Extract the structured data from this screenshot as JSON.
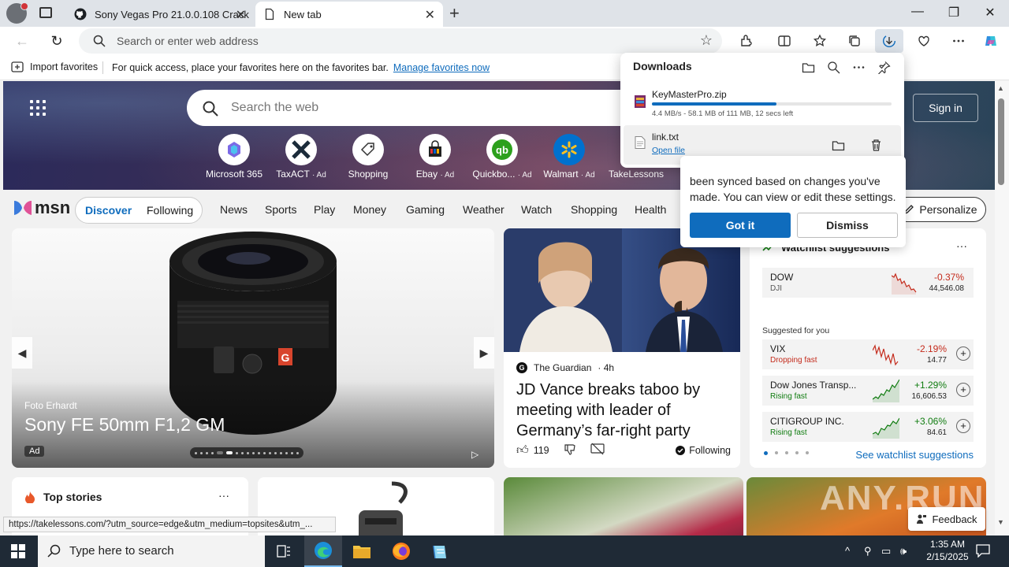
{
  "browser": {
    "tabs": [
      {
        "title": "Sony Vegas Pro 21.0.0.108 Crack",
        "icon": "github-icon",
        "active": false
      },
      {
        "title": "New tab",
        "icon": "page-icon",
        "active": true
      }
    ],
    "close_glyph": "✕",
    "new_tab_glyph": "+",
    "window_controls": [
      "—",
      "❐",
      "✕"
    ]
  },
  "toolbar": {
    "address_placeholder": "Search or enter web address",
    "back_glyph": "←",
    "refresh_glyph": "↻",
    "star_glyph": "☆"
  },
  "favorites_bar": {
    "import_label": "Import favorites",
    "message": "For quick access, place your favorites here on the favorites bar.",
    "manage_link": "Manage favorites now"
  },
  "downloads": {
    "title": "Downloads",
    "items": [
      {
        "name": "KeyMasterPro.zip",
        "status": "4.4 MB/s - 58.1 MB of 111 MB, 12 secs left",
        "progress": 0.52
      },
      {
        "name": "link.txt",
        "action": "Open file"
      }
    ]
  },
  "sync_popup": {
    "text": "been synced based on changes you've made. You can view or edit these settings.",
    "got_it": "Got it",
    "dismiss": "Dismiss"
  },
  "newtab": {
    "search_placeholder": "Search the web",
    "sign_in": "Sign in",
    "quick_links": [
      {
        "label": "Microsoft 365",
        "ad": ""
      },
      {
        "label": "TaxACT",
        "ad": "· Ad"
      },
      {
        "label": "Shopping",
        "ad": ""
      },
      {
        "label": "Ebay",
        "ad": "· Ad"
      },
      {
        "label": "Quickbo...",
        "ad": "· Ad"
      },
      {
        "label": "Walmart",
        "ad": "· Ad"
      },
      {
        "label": "TakeLessons",
        "ad": ""
      }
    ]
  },
  "msn": {
    "logo": "msn",
    "discover": "Discover",
    "following": "Following",
    "nav": [
      "News",
      "Sports",
      "Play",
      "Money",
      "Gaming",
      "Weather",
      "Watch",
      "Shopping",
      "Health"
    ],
    "personalize": "Personalize"
  },
  "carousel": {
    "credit": "Foto Erhardt",
    "headline": "Sony FE 50mm F1,2 GM",
    "ad_badge": "Ad"
  },
  "news": {
    "source": "The Guardian",
    "age": "· 4h",
    "title": "JD Vance breaks taboo by meeting with leader of Germany’s far-right party",
    "likes": "119",
    "following": "Following"
  },
  "watchlist": {
    "title": "Watchlist suggestions",
    "more": "···",
    "main": {
      "name": "DOW",
      "sub": "DJI",
      "change": "-0.37%",
      "price": "44,546.08"
    },
    "suggested_label": "Suggested for you",
    "suggestions": [
      {
        "name": "VIX",
        "sub": "Dropping fast",
        "change": "-2.19%",
        "price": "14.77",
        "trend": "down"
      },
      {
        "name": "Dow Jones Transp...",
        "sub": "Rising fast",
        "change": "+1.29%",
        "price": "16,606.53",
        "trend": "up"
      },
      {
        "name": "CITIGROUP INC.",
        "sub": "Rising fast",
        "change": "+3.06%",
        "price": "84.61",
        "trend": "up"
      }
    ],
    "link": "See watchlist suggestions"
  },
  "top_stories": {
    "title": "Top stories",
    "more": "···"
  },
  "feedback": "Feedback",
  "watermark": "ANY.RUN",
  "status_url": "https://takelessons.com/?utm_source=edge&utm_medium=topsites&utm_...",
  "taskbar": {
    "search_placeholder": "Type here to search",
    "time": "1:35 AM",
    "date": "2/15/2025"
  },
  "colors": {
    "accent": "#0f6cbd",
    "negative": "#c42b1c",
    "positive": "#107c10",
    "taskbar": "#1f2a36"
  }
}
